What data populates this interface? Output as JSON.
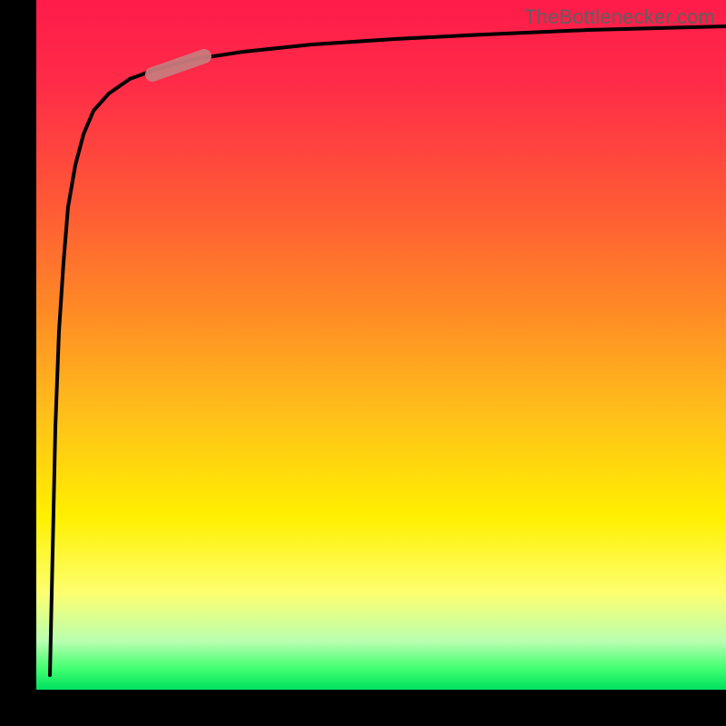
{
  "watermark": {
    "text": "TheBottlenecker.com"
  },
  "colors": {
    "bg_black": "#000000",
    "curve": "#000000",
    "marker": "#c87a7c",
    "watermark": "#5f5f5f",
    "gradient_stops": [
      "#ff1b4a",
      "#ff2b48",
      "#ff5a35",
      "#ff8a25",
      "#ffbf1a",
      "#fff000",
      "#fdff70",
      "#b9ffb0",
      "#40ff70",
      "#00e060"
    ]
  },
  "chart_data": {
    "type": "line",
    "title": "",
    "xlabel": "",
    "ylabel": "",
    "xlim": [
      0,
      100
    ],
    "ylim": [
      0,
      100
    ],
    "grid": false,
    "legend": false,
    "background": "red-yellow-green vertical gradient (red top → green bottom)",
    "series": [
      {
        "name": "bottleneck-curve",
        "x": [
          2,
          2.4,
          2.8,
          3.3,
          3.9,
          4.6,
          5.6,
          6.8,
          8.3,
          10.5,
          13.5,
          17.5,
          23,
          30,
          40,
          52,
          65,
          80,
          95,
          100
        ],
        "y": [
          2,
          20,
          38,
          52,
          62,
          70,
          76,
          80.5,
          84,
          86.5,
          88.5,
          90,
          91.4,
          92.5,
          93.5,
          94.3,
          95,
          95.6,
          96,
          96.2
        ],
        "marker_point": {
          "x": 20,
          "y": 91
        }
      }
    ],
    "notes": "Axis labels and tick marks are absent in the image; only the curve, a short pink highlight on the curve, a red→green vertical gradient background, and a watermark are visible."
  }
}
